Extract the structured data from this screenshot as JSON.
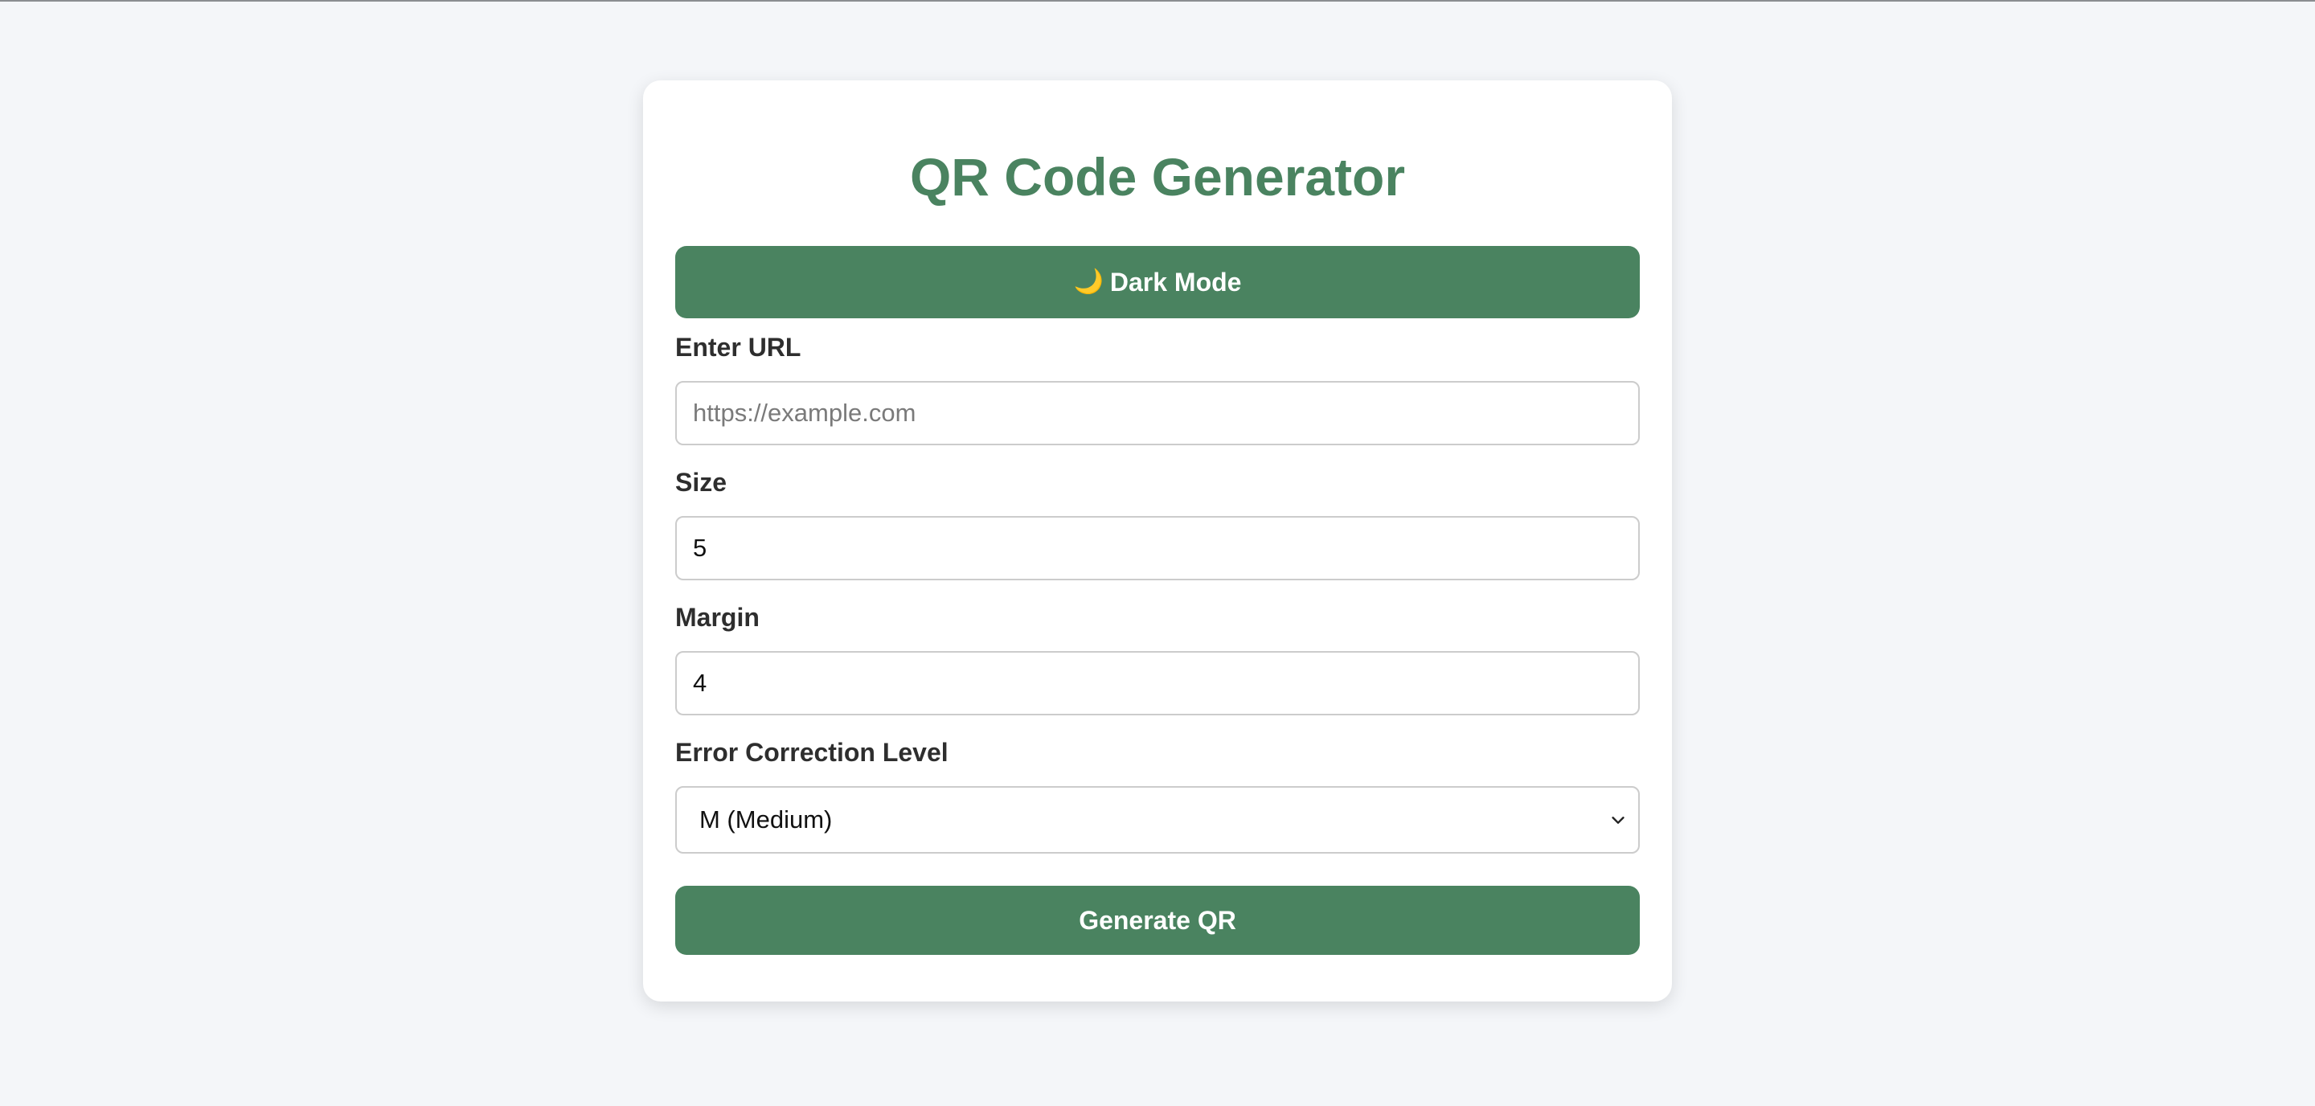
{
  "app": {
    "title": "QR Code Generator"
  },
  "theme_toggle": {
    "icon": "moon-icon",
    "icon_glyph": "🌙",
    "label": "Dark Mode"
  },
  "form": {
    "url": {
      "label": "Enter URL",
      "value": "",
      "placeholder": "https://example.com"
    },
    "size": {
      "label": "Size",
      "value": "5"
    },
    "margin": {
      "label": "Margin",
      "value": "4"
    },
    "error_correction": {
      "label": "Error Correction Level",
      "selected": "M (Medium)"
    }
  },
  "generate_button": {
    "label": "Generate QR"
  },
  "colors": {
    "accent": "#4a8360",
    "background": "#f4f6f9",
    "card": "#ffffff",
    "moon": "#f2c94c"
  }
}
